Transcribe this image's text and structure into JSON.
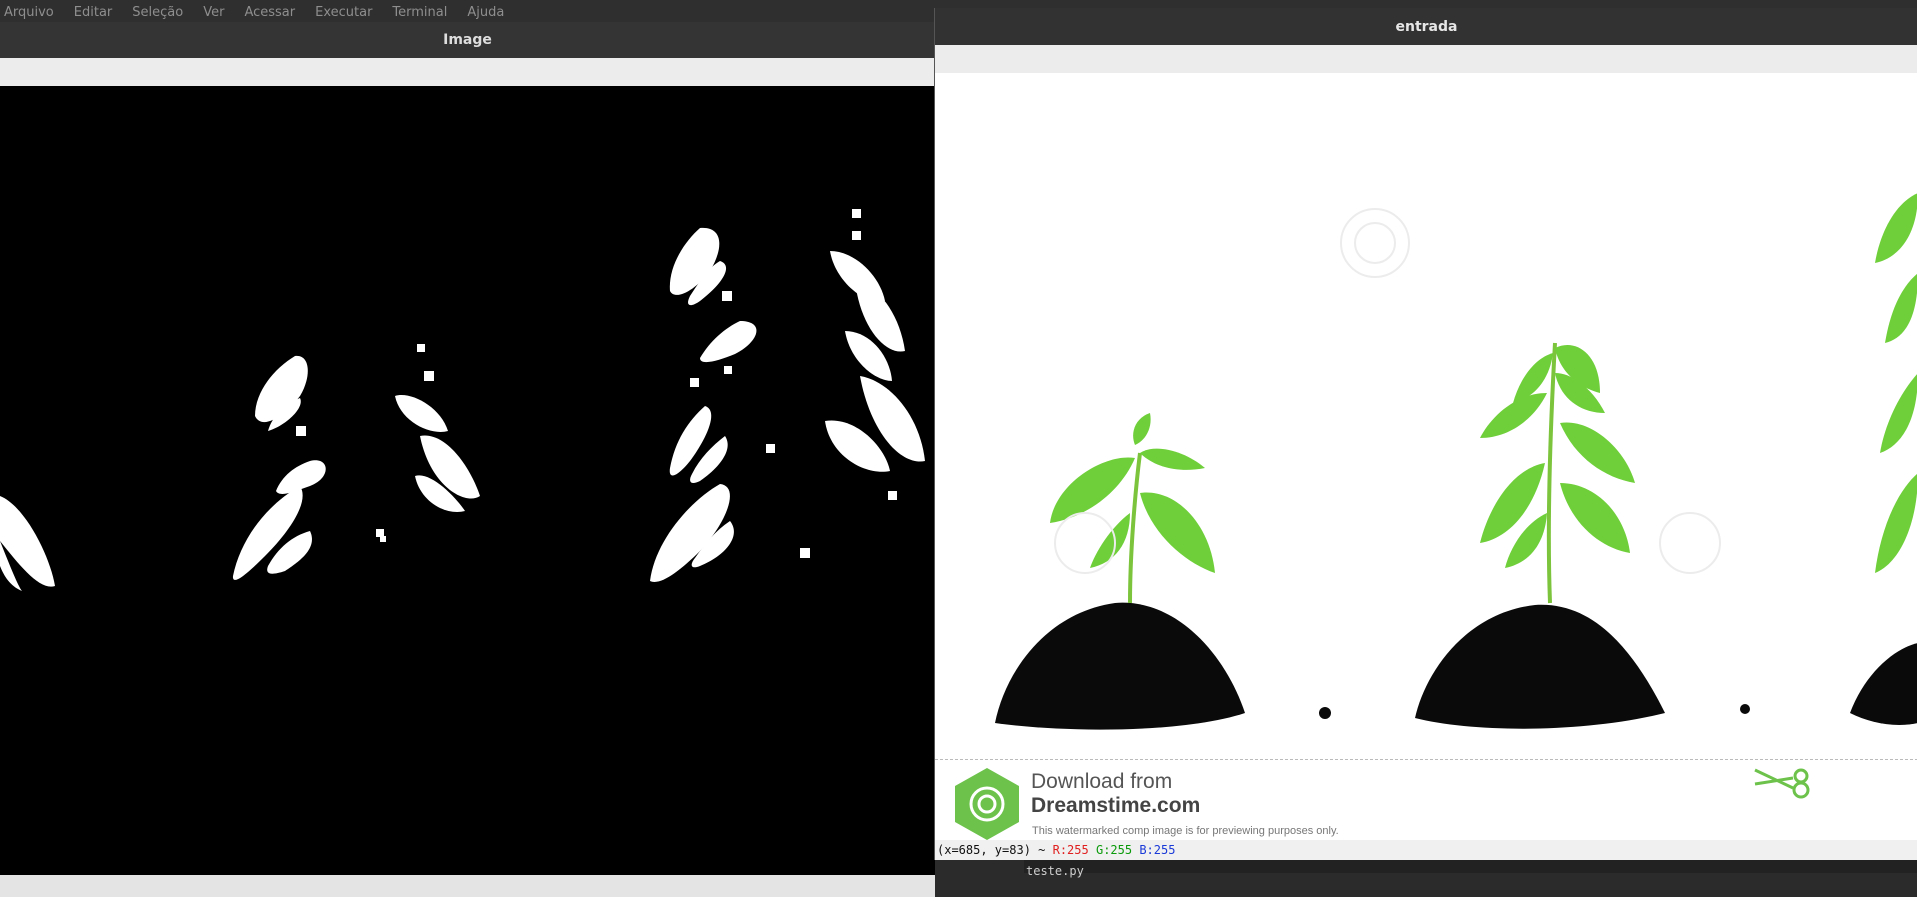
{
  "menubar": {
    "items": [
      "Arquivo",
      "Editar",
      "Seleção",
      "Ver",
      "Acessar",
      "Executar",
      "Terminal",
      "Ajuda"
    ]
  },
  "window_image": {
    "title": "Image"
  },
  "window_entrada": {
    "title": "entrada",
    "watermark": {
      "line1": "Download from",
      "line2": "Dreamstime.com",
      "note": "This watermarked comp image is for previewing purposes only."
    },
    "status": {
      "coords": "(x=685, y=83) ~",
      "r": "R:255",
      "g": "G:255",
      "b": "B:255"
    }
  },
  "terminal": {
    "text": "teste.py"
  },
  "colors": {
    "leaf_green": "#6fcf3a",
    "soil_black": "#0a0a0a",
    "logo_green": "#6cc24a"
  }
}
